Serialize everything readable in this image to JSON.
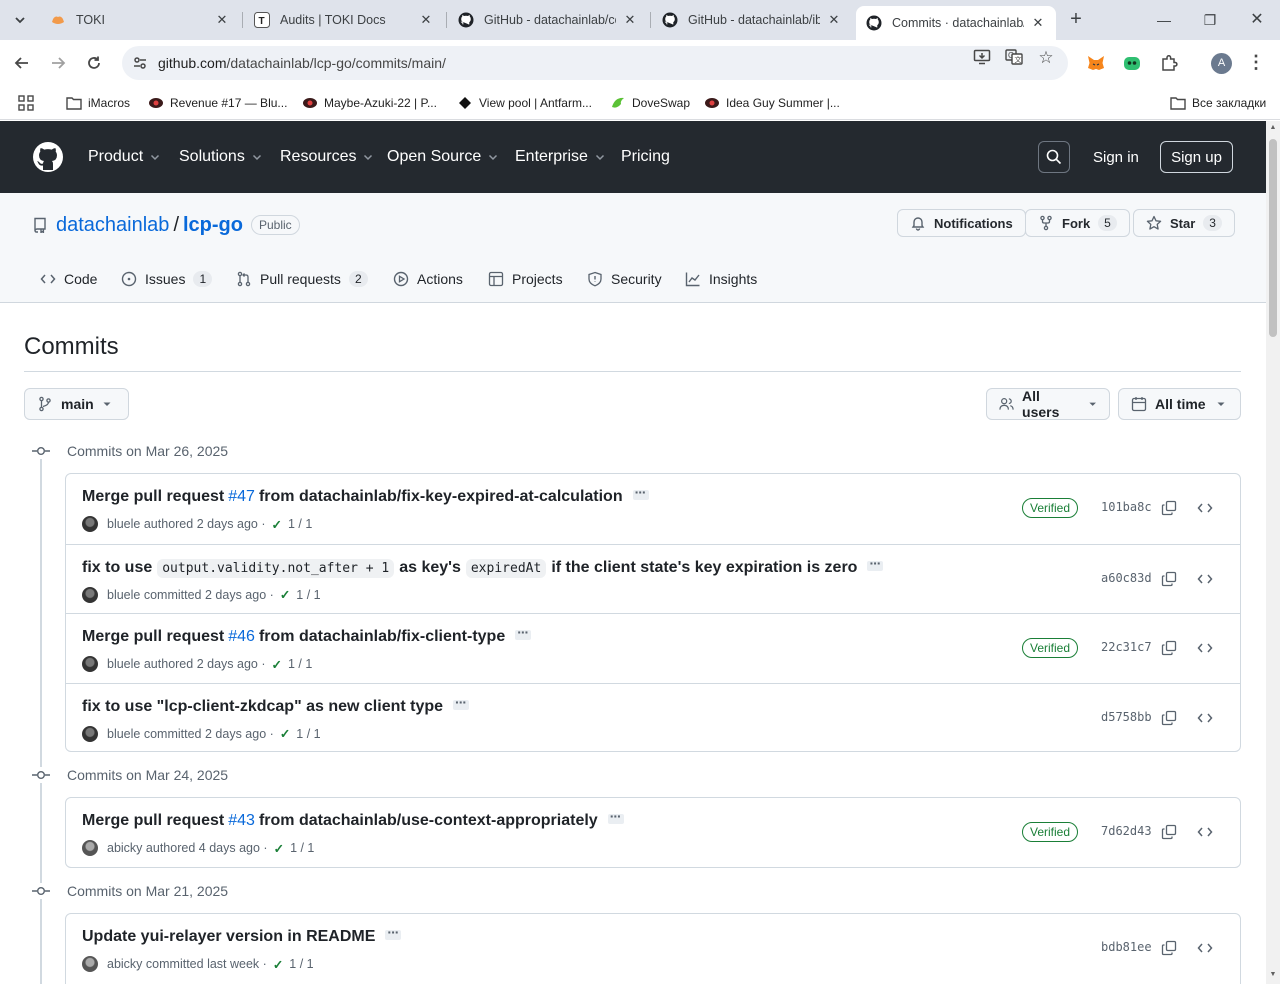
{
  "browser": {
    "tabs": [
      {
        "title": "TOKI",
        "favicon": "toki-icon"
      },
      {
        "title": "Audits | TOKI Docs",
        "favicon": "t-icon"
      },
      {
        "title": "GitHub - datachainlab/cc",
        "favicon": "github-icon"
      },
      {
        "title": "GitHub - datachainlab/ib",
        "favicon": "github-icon"
      },
      {
        "title": "Commits · datachainlab/l",
        "favicon": "github-icon"
      }
    ],
    "url_host": "github.com",
    "url_path": "/datachainlab/lcp-go/commits/main/",
    "profile_initial": "A",
    "bookmarks": [
      {
        "label": "iMacros"
      },
      {
        "label": "Revenue #17 — Blu..."
      },
      {
        "label": "Maybe-Azuki-22 | P..."
      },
      {
        "label": "View pool | Antfarm..."
      },
      {
        "label": "DoveSwap"
      },
      {
        "label": "Idea Guy Summer |..."
      }
    ],
    "all_bookmarks": "Все закладки"
  },
  "gh_header": {
    "nav": [
      "Product",
      "Solutions",
      "Resources",
      "Open Source",
      "Enterprise",
      "Pricing"
    ],
    "sign_in": "Sign in",
    "sign_up": "Sign up"
  },
  "repo": {
    "owner": "datachainlab",
    "slash": "/",
    "name": "lcp-go",
    "visibility": "Public",
    "notifications": "Notifications",
    "fork": "Fork",
    "fork_count": "5",
    "star": "Star",
    "star_count": "3",
    "tabs": [
      {
        "label": "Code",
        "count": ""
      },
      {
        "label": "Issues",
        "count": "1"
      },
      {
        "label": "Pull requests",
        "count": "2"
      },
      {
        "label": "Actions",
        "count": ""
      },
      {
        "label": "Projects",
        "count": ""
      },
      {
        "label": "Security",
        "count": ""
      },
      {
        "label": "Insights",
        "count": ""
      }
    ]
  },
  "commits_page": {
    "title": "Commits",
    "branch": "main",
    "users_filter": "All users",
    "time_filter": "All time",
    "groups": [
      {
        "heading": "Commits on Mar 26, 2025",
        "commits": [
          {
            "pre": "Merge pull request",
            "pr": "#47",
            "post": "from datachainlab/fix-key-expired-at-calculation",
            "author": "bluele",
            "action": "authored",
            "when": "2 days ago",
            "checks": "1 / 1",
            "verified": "Verified",
            "sha": "101ba8c"
          },
          {
            "pre": "fix to use",
            "code1": "output.validity.not_after + 1",
            "mid": "as key's",
            "code2": "expiredAt",
            "post": "if the client state's key expiration is zero",
            "author": "bluele",
            "action": "committed",
            "when": "2 days ago",
            "checks": "1 / 1",
            "verified": "",
            "sha": "a60c83d"
          },
          {
            "pre": "Merge pull request",
            "pr": "#46",
            "post": "from datachainlab/fix-client-type",
            "author": "bluele",
            "action": "authored",
            "when": "2 days ago",
            "checks": "1 / 1",
            "verified": "Verified",
            "sha": "22c31c7"
          },
          {
            "pre": "fix to use \"lcp-client-zkdcap\" as new client type",
            "author": "bluele",
            "action": "committed",
            "when": "2 days ago",
            "checks": "1 / 1",
            "verified": "",
            "sha": "d5758bb"
          }
        ]
      },
      {
        "heading": "Commits on Mar 24, 2025",
        "commits": [
          {
            "pre": "Merge pull request",
            "pr": "#43",
            "post": "from datachainlab/use-context-appropriately",
            "author": "abicky",
            "action": "authored",
            "when": "4 days ago",
            "checks": "1 / 1",
            "verified": "Verified",
            "sha": "7d62d43"
          }
        ]
      },
      {
        "heading": "Commits on Mar 21, 2025",
        "commits": [
          {
            "pre": "Update yui-relayer version in README",
            "author": "abicky",
            "action": "committed",
            "when": "last week",
            "checks": "1 / 1",
            "verified": "",
            "sha": "bdb81ee"
          }
        ]
      }
    ]
  },
  "colors": {
    "header_bg": "#24292f",
    "link": "#0969da",
    "verified": "#1a7f37"
  }
}
